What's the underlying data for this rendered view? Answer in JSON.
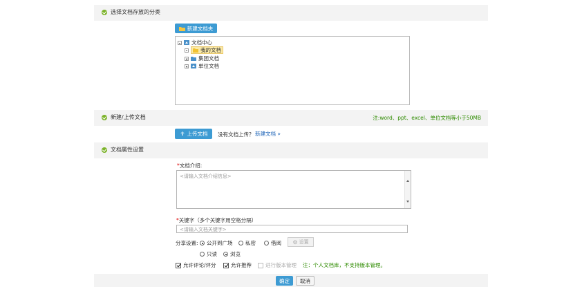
{
  "section1": {
    "title": "选择文档存放的分类"
  },
  "new_folder_button": "新建文档夹",
  "tree": {
    "root": "文档中心",
    "items": [
      {
        "label": "我的文档",
        "selected": true,
        "expander": "minus"
      },
      {
        "label": "集团文档",
        "expander": "plus"
      },
      {
        "label": "单位文档",
        "expander": "plus"
      }
    ]
  },
  "section2": {
    "title": "新建/上传文档",
    "note": "注:word、ppt、excel、单位文档等小于50MB"
  },
  "upload_button": "上传文档",
  "no_doc_text": "没有文档上传？",
  "new_doc_link": "新建文档 »",
  "section3": {
    "title": "文档属性设置"
  },
  "intro": {
    "req_mark": "*",
    "label": "文档介绍:",
    "placeholder": "<请输入文档介绍信息>"
  },
  "keywords": {
    "req_mark": "*",
    "label": "关键字（多个关键字用空格分隔）",
    "placeholder": "<请输入文档关键字>"
  },
  "share": {
    "label": "分享设置:",
    "options": [
      "公开到广场",
      "私密",
      "借阅"
    ],
    "selected": "公开到广场",
    "settings_button": "设置"
  },
  "access": {
    "options": [
      "只读",
      "浏览"
    ],
    "selected": "浏览"
  },
  "checks": {
    "allow_comment": "允许评论/评分",
    "allow_recommend": "允许推荐",
    "version_mgmt": "进行版本管理",
    "note": "注：个人文档库，不支持版本管理。"
  },
  "footer": {
    "confirm": "确定",
    "cancel": "取消"
  },
  "colors": {
    "accent": "#3d9bd3",
    "note_green": "#2e8b00",
    "section_icon": "#7cb32a"
  }
}
